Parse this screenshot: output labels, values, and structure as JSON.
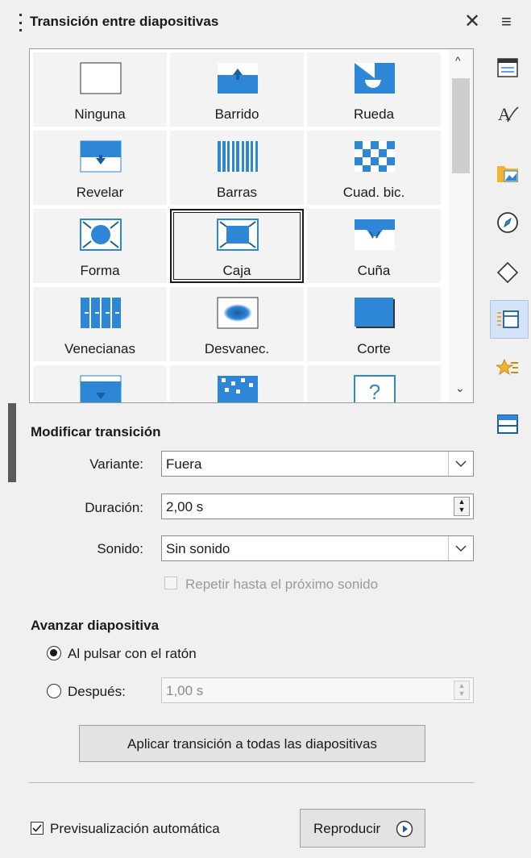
{
  "panel": {
    "title": "Transición entre diapositivas",
    "close_glyph": "✕",
    "menu_glyph": "≡"
  },
  "gallery": {
    "items": [
      {
        "label": "Ninguna",
        "icon": "none-transition-icon"
      },
      {
        "label": "Barrido",
        "icon": "wipe-transition-icon"
      },
      {
        "label": "Rueda",
        "icon": "wheel-transition-icon"
      },
      {
        "label": "Revelar",
        "icon": "uncover-transition-icon"
      },
      {
        "label": "Barras",
        "icon": "bars-transition-icon"
      },
      {
        "label": "Cuad. bic.",
        "icon": "checkerboard-transition-icon"
      },
      {
        "label": "Forma",
        "icon": "shape-transition-icon"
      },
      {
        "label": "Caja",
        "icon": "box-transition-icon"
      },
      {
        "label": "Cuña",
        "icon": "wedge-transition-icon"
      },
      {
        "label": "Venecianas",
        "icon": "venetian-transition-icon"
      },
      {
        "label": "Desvanec.",
        "icon": "fade-transition-icon"
      },
      {
        "label": "Corte",
        "icon": "cut-transition-icon"
      }
    ],
    "selected": "Caja",
    "accent": "#2e86d6"
  },
  "modify": {
    "heading": "Modificar transición",
    "variant_label": "Variante:",
    "variant_value": "Fuera",
    "duration_label": "Duración:",
    "duration_value": "2,00 s",
    "sound_label": "Sonido:",
    "sound_value": "Sin sonido",
    "loop_label": "Repetir hasta el próximo sonido",
    "loop_checked": false
  },
  "advance": {
    "heading": "Avanzar diapositiva",
    "on_click_label": "Al pulsar con el ratón",
    "on_click_selected": true,
    "after_label": "Después:",
    "after_value": "1,00 s"
  },
  "apply_all_label": "Aplicar transición a todas las diapositivas",
  "preview": {
    "label": "Previsualización automática",
    "checked": true
  },
  "play_label": "Reproducir"
}
